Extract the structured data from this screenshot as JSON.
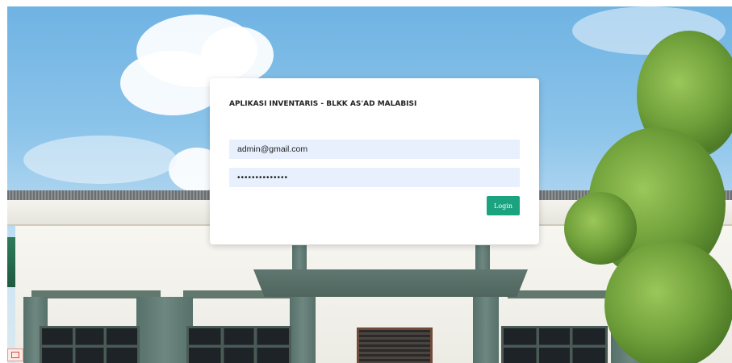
{
  "app": {
    "title": "APLIKASI INVENTARIS - BLKK AS'AD MALABISI"
  },
  "login_form": {
    "email_value": "admin@gmail.com",
    "password_value": "••••••••••••••",
    "login_label": "Login"
  },
  "colors": {
    "accent": "#1aa37e",
    "input_background": "#e8f0fe",
    "card_background": "#ffffff"
  },
  "icons": {
    "corner_badge": "logo-icon"
  }
}
